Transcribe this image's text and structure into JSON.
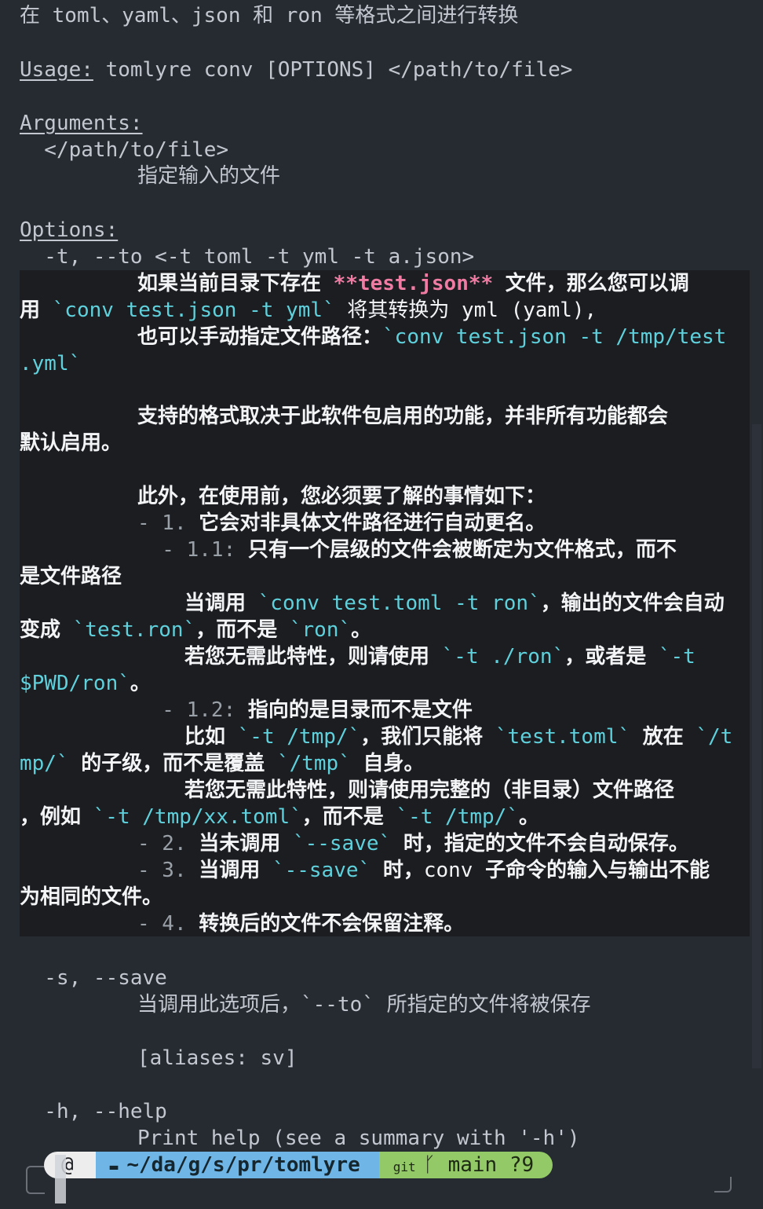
{
  "help": {
    "description": "在 toml、yaml、json 和 ron 等格式之间进行转换",
    "usage_label": "Usage:",
    "usage_text": " tomlyre conv [OPTIONS] </path/to/file>",
    "arguments_label": "Arguments:",
    "argument_name": "  </path/to/file>",
    "argument_desc": "指定输入的文件",
    "options_label": "Options:",
    "opt_to_flag": "  -t, --to <-t toml -t yml -t a.json>",
    "to_desc": {
      "l1_a": "如果当前目录下存在 ",
      "l1_b": "**test.json**",
      "l1_c": " 文件，那么您可以调",
      "l2_a": "用 ",
      "l2_b": "`conv test.json -t yml`",
      "l2_c": " 将其转换为 yml (yaml),",
      "l3_a": "也可以手动指定文件路径：",
      "l3_b": "`conv test.json -t /tmp/test",
      "l4": ".yml`",
      "l5": "支持的格式取决于此软件包启用的功能，并非所有功能都会",
      "l6": "默认启用。",
      "l7": "此外，在使用前，您必须要了解的事情如下：",
      "l8_a": "- 1. ",
      "l8_b": "它会对非具体文件路径进行自动更名。",
      "l9_a": "  - 1.1: ",
      "l9_b": "只有一个层级的文件会被断定为文件格式，而不",
      "l10": "是文件路径",
      "l11_a": "当调用 ",
      "l11_b": "`conv test.toml -t ron`",
      "l11_c": "，输出的文件会自动",
      "l12_a": "变成 ",
      "l12_b": "`test.ron`",
      "l12_c": "，而不是 ",
      "l12_d": "`ron`",
      "l12_e": "。",
      "l13_a": "若您无需此特性，则请使用 ",
      "l13_b": "`-t ./ron`",
      "l13_c": "，或者是 ",
      "l13_d": "`-t",
      "l14_a": "$PWD/ron`",
      "l14_b": "。",
      "l15_a": "  - 1.2: ",
      "l15_b": "指向的是目录而不是文件",
      "l16_a": "比如 ",
      "l16_b": "`-t /tmp/`",
      "l16_c": "，我们只能将 ",
      "l16_d": "`test.toml`",
      "l16_e": " 放在 ",
      "l16_f": "`/t",
      "l17_a": "mp/`",
      "l17_b": " 的子级，而不是覆盖 ",
      "l17_c": "`/tmp`",
      "l17_d": " 自身。",
      "l18": "若您无需此特性，则请使用完整的（非目录）文件路径",
      "l19_a": "，例如 ",
      "l19_b": "`-t /tmp/xx.toml`",
      "l19_c": "，而不是 ",
      "l19_d": "`-t /tmp/`",
      "l19_e": "。",
      "l20_a": "- 2. ",
      "l20_b": "当未调用 ",
      "l20_c": "`--save`",
      "l20_d": " 时，指定的文件不会自动保存。",
      "l21_a": "- 3. ",
      "l21_b": "当调用 ",
      "l21_c": "`--save`",
      "l21_d": " 时，",
      "l21_e": "conv",
      "l21_f": " 子命令的输入与输出不能",
      "l22": "为相同的文件。",
      "l23_a": "- 4. ",
      "l23_b": "转换后的文件不会保留注释。"
    },
    "opt_save_flag": "  -s, --save",
    "save_desc": "当调用此选项后，`--to` 所指定的文件将被保存",
    "save_aliases": "[aliases: sv]",
    "opt_help_flag": "  -h, --help",
    "help_desc": "Print help (see a summary with '-h')"
  },
  "prompt": {
    "os_icon": "debian-swirl-icon",
    "path_icon": "folder-icon",
    "path": "~/da/g/s/pr/tomlyre",
    "git_icon": "git-icon",
    "branch_icon": "branch-icon",
    "branch": "main",
    "status": "?9"
  },
  "colors": {
    "background": "#262a31",
    "highlight_bg": "#1b1d21",
    "code": "#5fd1dc",
    "bold_marker": "#f07ca3",
    "path_segment": "#6fb6e6",
    "git_segment": "#93c967"
  }
}
